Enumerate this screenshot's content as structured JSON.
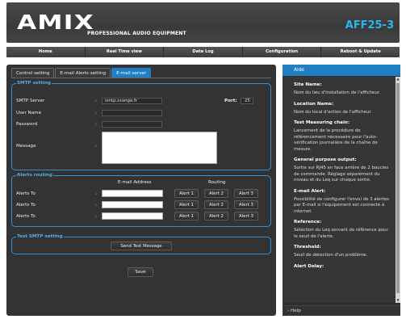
{
  "header": {
    "logo": "AMIX",
    "tagline": "PROFESSIONAL AUDIO EQUIPMENT",
    "model": "AFF25-3",
    "brand_accent": "#2ab6f0"
  },
  "nav": [
    "Home",
    "Real Time view",
    "Data Log",
    "Configuration",
    "Reboot & Update"
  ],
  "tabs": [
    "Control setting",
    "E-mail Alerts setting",
    "E-mail server"
  ],
  "active_tab": "E-mail server",
  "smtp": {
    "legend": "SMTP setting",
    "server_label": "SMTP Server",
    "server_value": "smtp.orange.fr",
    "port_label": "Port:",
    "port_value": "25",
    "user_label": "User Name",
    "user_value": "",
    "password_label": "Password",
    "password_value": "",
    "message_label": "Message",
    "message_value": ""
  },
  "routing": {
    "legend": "Alerts routing",
    "email_header": "E-mail Address",
    "routing_header": "Routing",
    "rows": [
      {
        "label": "Alerts To",
        "email": "",
        "buttons": [
          "Alert 1",
          "Alert 2",
          "Alert 3"
        ]
      },
      {
        "label": "Alerts To",
        "email": "",
        "buttons": [
          "Alert 1",
          "Alert 2",
          "Alert 3"
        ]
      },
      {
        "label": "Alerts To",
        "email": "",
        "buttons": [
          "Alert 1",
          "Alert 2",
          "Alert 3"
        ]
      }
    ]
  },
  "test": {
    "legend": "Test SMTP setting",
    "button": "Send Test Message"
  },
  "save_button": "Save",
  "colon": ":",
  "aside": {
    "title": "Aide",
    "items": [
      {
        "term": "Site Name:",
        "desc": "Nom du lieu d'installation de l'afficheur."
      },
      {
        "term": "Location Name:",
        "desc": "Nom du local d'action de l'afficheur."
      },
      {
        "term": "Test Measuring chain:",
        "desc": "Lancement de la procédure de référencement nécessaire pour l'auto-vérification journalière de la chaîne de mesure."
      },
      {
        "term": "General purpose output:",
        "desc": "Sortie sur RJ45 en face arrière de 2 boucles de commande. Réglage séparément du niveau et du Leq sur chaque sortie."
      },
      {
        "term": "E-mail Alert:",
        "desc": "Possibilité de configurer l'envoi de 3 alertes par E-mail si l'équipement est connecté à internet."
      },
      {
        "term": "Reference:",
        "desc": "Sélection du Leq servant de référence pour le seuil de l'alerte."
      },
      {
        "term": "Threshold:",
        "desc": "Seuil de detection d'un problème."
      },
      {
        "term": "Alert Delay:",
        "desc": ""
      }
    ],
    "footer": "Help"
  }
}
